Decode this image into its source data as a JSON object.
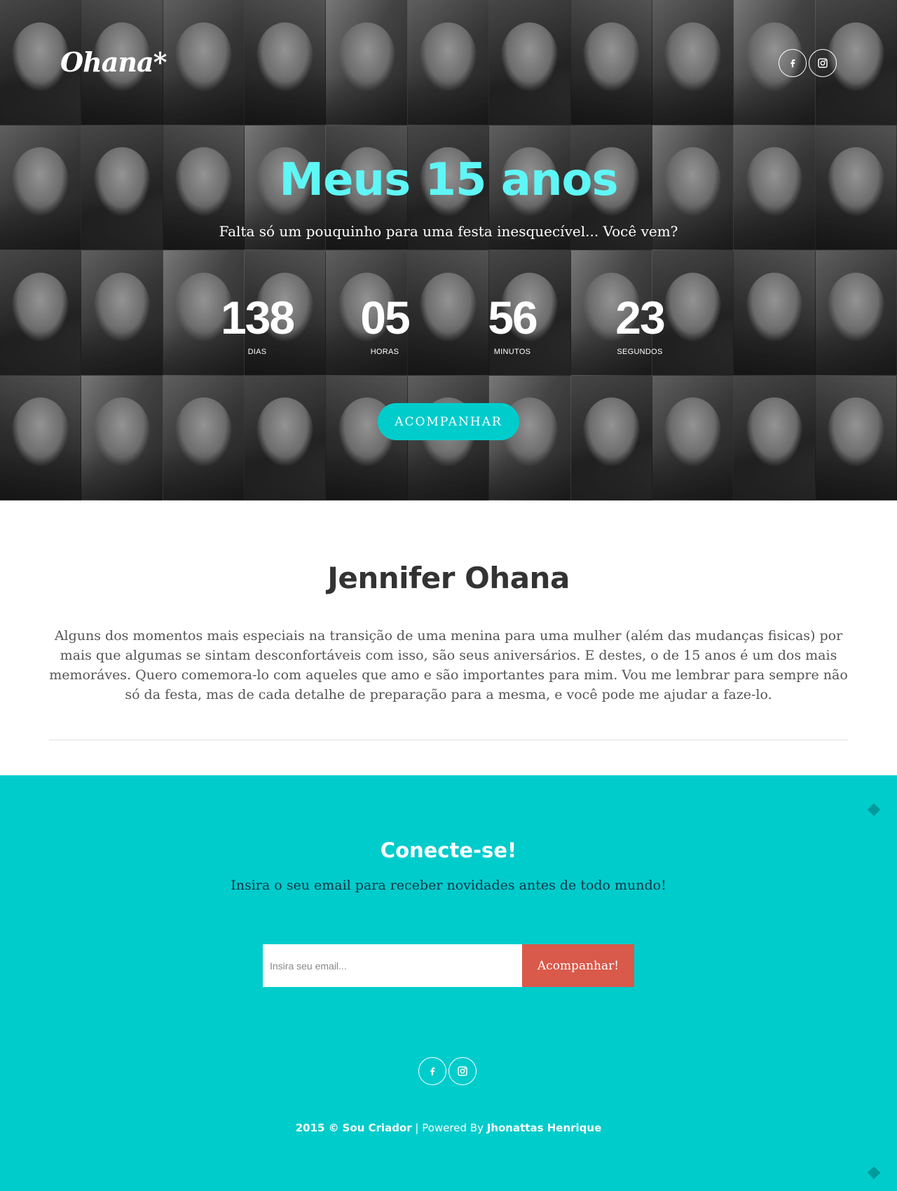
{
  "header": {
    "logo": "Ohana*",
    "social": [
      "facebook-icon",
      "instagram-icon"
    ]
  },
  "hero": {
    "title": "Meus 15 anos",
    "subtitle": "Falta só um pouquinho para uma festa inesquecível... Você vem?",
    "countdown": [
      {
        "value": "138",
        "label": "DIAS"
      },
      {
        "value": "05",
        "label": "HORAS"
      },
      {
        "value": "56",
        "label": "MINUTOS"
      },
      {
        "value": "23",
        "label": "SEGUNDOS"
      }
    ],
    "button_label": "ACOMPANHAR"
  },
  "about": {
    "title": "Jennifer Ohana",
    "text": "Alguns dos momentos mais especiais na transição de uma menina para uma mulher (além das mudanças fisicas) por mais que algumas se sintam desconfortáveis com isso, são seus aniversários. E destes, o de 15 anos é um dos mais memoráves. Quero comemora-lo com aqueles que amo e são importantes para mim. Vou me lembrar para sempre não só da festa, mas de cada detalhe de preparação para a mesma, e você pode me ajudar a faze-lo."
  },
  "connect": {
    "title": "Conecte-se!",
    "subtitle": "Insira o seu email para receber novidades antes de todo mundo!",
    "email_placeholder": "Insira seu email...",
    "button_label": "Acompanhar!"
  },
  "footer": {
    "year_copy": "2015 ©",
    "brand": "Sou Criador",
    "separator": "| Powered By",
    "author": "Jhonattas Henrique"
  },
  "colors": {
    "accent": "#00cccc",
    "title_cyan": "#5ff6f6",
    "subscribe": "#d9594a"
  }
}
